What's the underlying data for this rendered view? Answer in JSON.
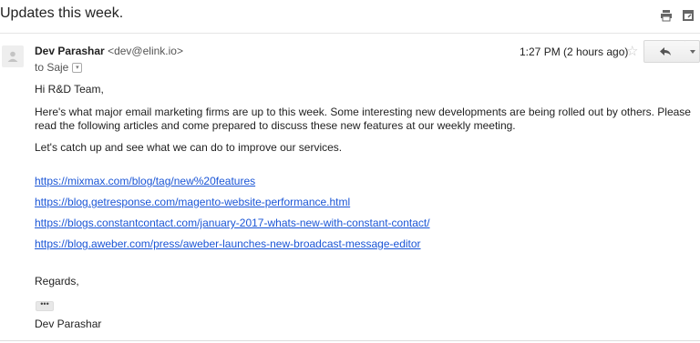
{
  "subject": "Updates this week.",
  "top_actions": [
    {
      "icon": "print-icon"
    },
    {
      "icon": "open-in-new-window-icon"
    }
  ],
  "message": {
    "sender_name": "Dev Parashar",
    "sender_email": "<dev@elink.io>",
    "to_label": "to Saje",
    "time": "1:27 PM (2 hours ago)",
    "star_icon": "star-icon",
    "reply_icon": "reply-icon",
    "more_icon": "more-options-icon",
    "greeting": "Hi R&D Team,",
    "intro": "Here's what major email marketing firms are up to this week. Some interesting new developments are being rolled out by others. Please read the following articles and come prepared to discuss these new features at our weekly meeting.",
    "catch_up": "Let's catch up and see what we can do to improve our services.",
    "links": [
      "https://mixmax.com/blog/tag/new%20features",
      "https://blog.getresponse.com/magento-website-performance.html",
      "https://blogs.constantcontact.com/january-2017-whats-new-with-constant-contact/",
      "https://blog.aweber.com/press/aweber-launches-new-broadcast-message-editor"
    ],
    "regards": "Regards,",
    "ellipsis": "•••",
    "signature": "Dev Parashar"
  }
}
